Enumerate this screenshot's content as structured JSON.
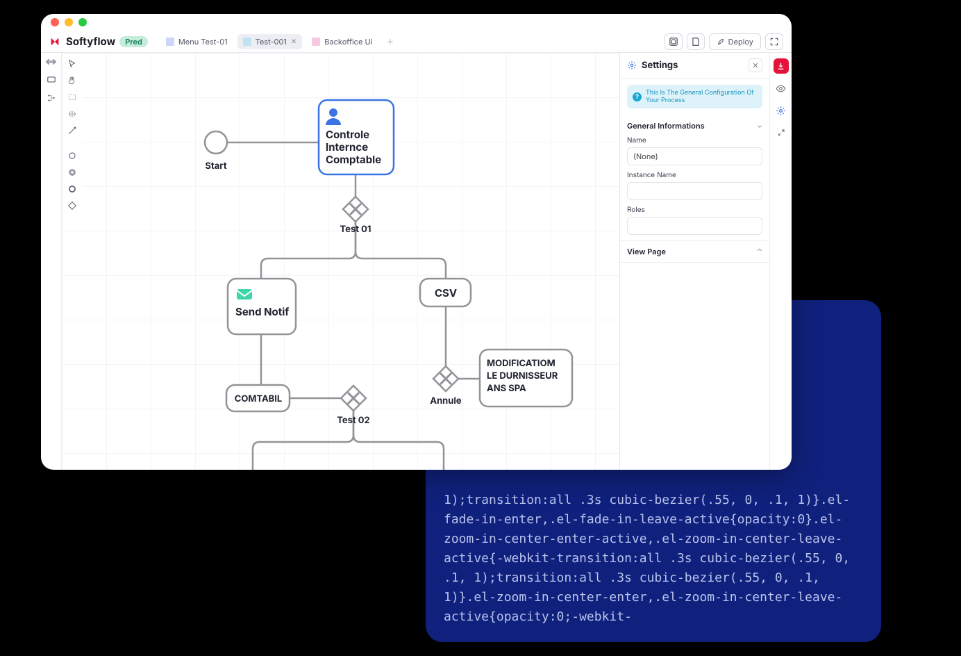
{
  "brand": "Softyflow",
  "env_badge": "Pred",
  "tabs": [
    {
      "label": "Menu Test-01"
    },
    {
      "label": "Test-001",
      "active": true
    },
    {
      "label": "Backoffice Ui"
    }
  ],
  "topbar": {
    "deploy_label": "Deploy"
  },
  "canvas": {
    "start_label": "Start",
    "task_controle": "Controle\nInternce\nComptable",
    "gw_test01": "Test 01",
    "task_send_notif": "Send Notif",
    "task_csv": "CSV",
    "task_comtabil": "COMTABIL",
    "gw_test02": "Test 02",
    "gw_annule": "Annule",
    "task_modif": "MODIFICATIOM\nLE DURNISSEUR\nANS SPA"
  },
  "settings": {
    "title": "Settings",
    "hint": "This Is The General Configuration Of Your Process",
    "section_general": "General Informations",
    "field_name_label": "Name",
    "field_name_value": "(None)",
    "field_instance_label": "Instance Name",
    "field_roles_label": "Roles",
    "section_view": "View Page"
  },
  "code_overlay": "in-linear-\n\n,.fade-in-\nfade-in-\nebkit-\n.el-fade-\nar-leave-\nave-\n\n1);transition:all .3s cubic-bezier(.55, 0, .1, 1)}.el-fade-in-enter,.el-fade-in-leave-active{opacity:0}.el-zoom-in-center-enter-active,.el-zoom-in-center-leave-active{-webkit-transition:all .3s cubic-bezier(.55, 0, .1, 1);transition:all .3s cubic-bezier(.55, 0, .1, 1)}.el-zoom-in-center-enter,.el-zoom-in-center-leave-active{opacity:0;-webkit-"
}
